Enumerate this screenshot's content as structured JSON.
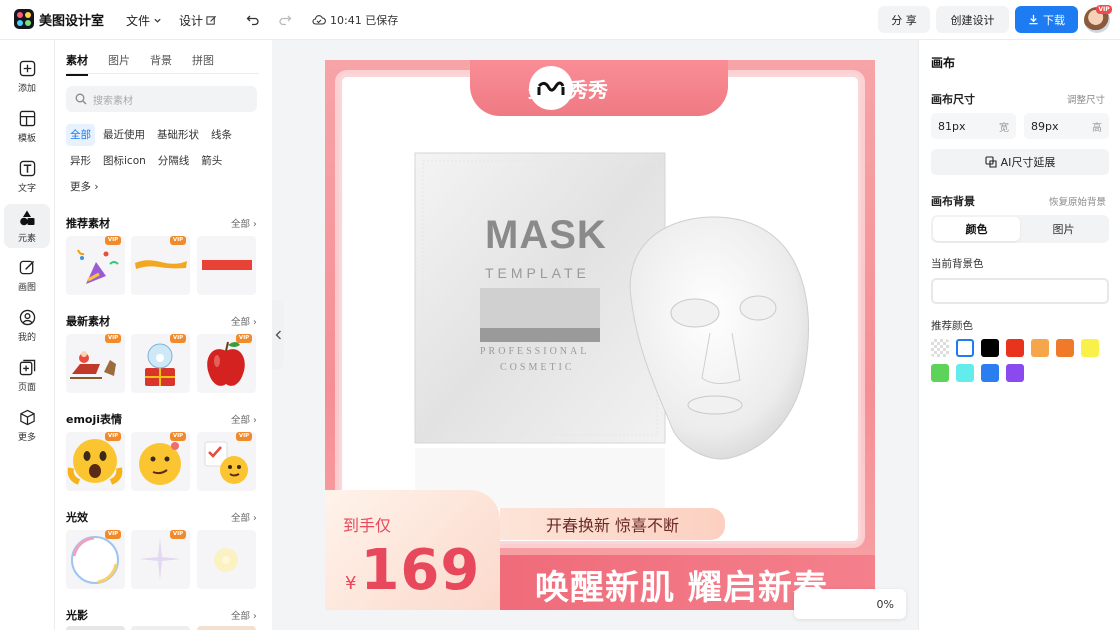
{
  "app": {
    "name": "美图设计室",
    "menu_file": "文件",
    "menu_design": "设计",
    "save_status": "10:41 已保存",
    "share": "分 享",
    "create_design": "创建设计",
    "download": "下载",
    "avatar_badge": "VIP"
  },
  "rail": [
    {
      "label": "添加",
      "icon": "plus-square-icon"
    },
    {
      "label": "模板",
      "icon": "template-icon"
    },
    {
      "label": "文字",
      "icon": "text-icon"
    },
    {
      "label": "元素",
      "icon": "shapes-icon"
    },
    {
      "label": "画图",
      "icon": "draw-icon"
    },
    {
      "label": "我的",
      "icon": "user-icon"
    },
    {
      "label": "页面",
      "icon": "page-add-icon"
    },
    {
      "label": "更多",
      "icon": "cube-icon"
    }
  ],
  "panel": {
    "tabs": [
      "素材",
      "图片",
      "背景",
      "拼图"
    ],
    "search_placeholder": "搜索素材",
    "chips": [
      "全部",
      "最近使用",
      "基础形状",
      "线条",
      "异形",
      "图标icon",
      "分隔线",
      "箭头",
      "更多"
    ],
    "all_label": "全部",
    "vip": "VIP",
    "sections": [
      "推荐素材",
      "最新素材",
      "emoji表情",
      "光效",
      "光影"
    ]
  },
  "canvas": {
    "brand": "美图秀秀",
    "mask_title": "MASK",
    "mask_sub": "TEMPLATE",
    "mask_line1": "PROFESSIONAL",
    "mask_line2": "COSMETIC",
    "price_label": "到手仅",
    "currency": "¥",
    "price": "169",
    "promo": "开春换新 惊喜不断",
    "slogan": "唤醒新肌 耀启新春",
    "zoom": "0%"
  },
  "props": {
    "title": "画布",
    "size_label": "画布尺寸",
    "adjust_size": "调整尺寸",
    "width_value": "81px",
    "width_unit": "宽",
    "height_value": "89px",
    "height_unit": "高",
    "ai_extend": "AI尺寸延展",
    "bg_label": "画布背景",
    "restore_bg": "恢复原始背景",
    "seg_color": "颜色",
    "seg_image": "图片",
    "current_bg": "当前背景色",
    "recommend": "推荐颜色",
    "swatches": [
      "transparent",
      "#ffffff",
      "#000000",
      "#e8341c",
      "#f5a54a",
      "#f07a2a",
      "#f7f14a",
      "#5dd35a",
      "#62ecec",
      "#2b7ef0",
      "#8b4af0"
    ]
  },
  "colors": {
    "accent": "#1e7cf2",
    "price": "#e8485c"
  }
}
